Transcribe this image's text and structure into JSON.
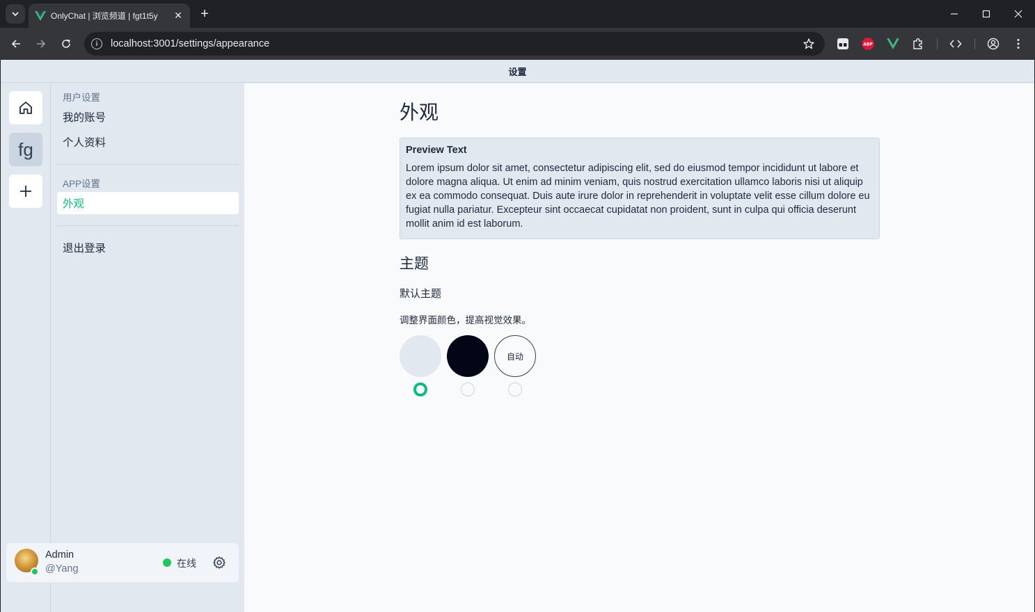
{
  "browser": {
    "tab_title": "OnlyChat | 浏览频道 | fgt1t5y",
    "url": "localhost:3001/settings/appearance"
  },
  "app": {
    "header_title": "设置"
  },
  "rail": {
    "channel_label": "fg"
  },
  "sidebar": {
    "groups": [
      {
        "label": "用户设置",
        "items": [
          {
            "label": "我的账号"
          },
          {
            "label": "个人资料"
          }
        ]
      },
      {
        "label": "APP设置",
        "items": [
          {
            "label": "外观",
            "active": true
          }
        ]
      }
    ],
    "logout_label": "退出登录"
  },
  "user": {
    "name": "Admin",
    "handle": "@Yang",
    "status": "在线"
  },
  "page": {
    "title": "外观",
    "preview_title": "Preview Text",
    "preview_body": "Lorem ipsum dolor sit amet, consectetur adipiscing elit, sed do eiusmod tempor incididunt ut labore et dolore magna aliqua. Ut enim ad minim veniam, quis nostrud exercitation ullamco laboris nisi ut aliquip ex ea commodo consequat. Duis aute irure dolor in reprehenderit in voluptate velit esse cillum dolore eu fugiat nulla pariatur. Excepteur sint occaecat cupidatat non proident, sunt in culpa qui officia deserunt mollit anim id est laborum.",
    "section_title": "主题",
    "theme_title": "默认主题",
    "theme_desc": "调整界面颜色，提高视觉效果。",
    "themes": [
      {
        "name": "light",
        "label": "",
        "color": "#e2e8f0",
        "selected": true
      },
      {
        "name": "dark",
        "label": "",
        "color": "#020617",
        "selected": false
      },
      {
        "name": "auto",
        "label": "自动",
        "color": "#f8fafc",
        "selected": false
      }
    ]
  },
  "colors": {
    "accent": "#10b981",
    "online": "#22c55e"
  },
  "icons": [
    "back-icon",
    "forward-icon",
    "reload-icon",
    "info-icon",
    "star-icon",
    "home-icon",
    "plus-icon",
    "gear-icon"
  ]
}
